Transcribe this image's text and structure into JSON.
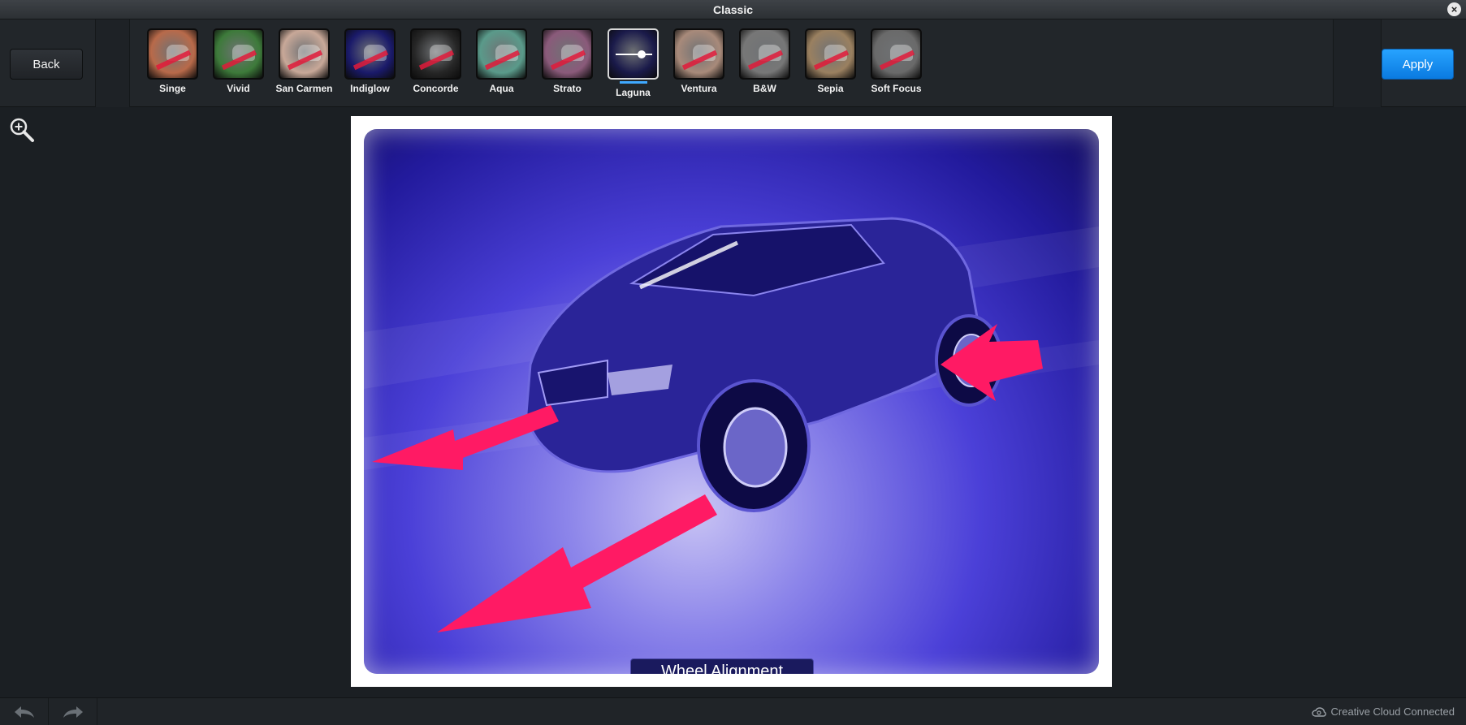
{
  "window": {
    "title": "Classic"
  },
  "toolbar": {
    "back_label": "Back",
    "apply_label": "Apply"
  },
  "filters": [
    {
      "label": "Singe",
      "tint": "#b86a4a"
    },
    {
      "label": "Vivid",
      "tint": "#3d7a3a"
    },
    {
      "label": "San Carmen",
      "tint": "#c8a898"
    },
    {
      "label": "Indiglow",
      "tint": "#1a1a6a"
    },
    {
      "label": "Concorde",
      "tint": "#262626"
    },
    {
      "label": "Aqua",
      "tint": "#5a9a8a"
    },
    {
      "label": "Strato",
      "tint": "#8a5a7a"
    },
    {
      "label": "Laguna",
      "tint": "#1a1a4a",
      "active": true
    },
    {
      "label": "Ventura",
      "tint": "#a88a7a"
    },
    {
      "label": "B&W",
      "tint": "#777777"
    },
    {
      "label": "Sepia",
      "tint": "#9a8060"
    },
    {
      "label": "Soft Focus",
      "tint": "#6a6a6a"
    }
  ],
  "photo": {
    "caption": "Wheel Alignment"
  },
  "status": {
    "cloud_text": "Creative Cloud Connected"
  },
  "icons": {
    "zoom": "zoom-in-icon",
    "undo": "undo-icon",
    "redo": "redo-icon",
    "cloud": "creative-cloud-icon",
    "close": "close-icon"
  }
}
